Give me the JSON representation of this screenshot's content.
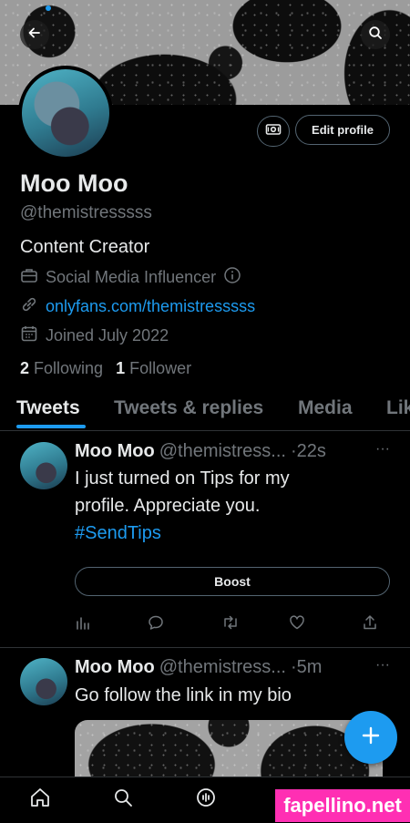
{
  "profile": {
    "name": "Moo Moo",
    "handle": "@themistresssss",
    "bio": "Content Creator",
    "category": "Social Media Influencer",
    "link": "onlyfans.com/themistresssss",
    "joined": "Joined July 2022",
    "following_count": "2",
    "following_label": "Following",
    "followers_count": "1",
    "followers_label": "Follower"
  },
  "header": {
    "edit_profile_label": "Edit profile"
  },
  "tabs": [
    {
      "label": "Tweets",
      "active": true
    },
    {
      "label": "Tweets & replies",
      "active": false
    },
    {
      "label": "Media",
      "active": false
    },
    {
      "label": "Lik",
      "active": false
    }
  ],
  "tweets": [
    {
      "name": "Moo Moo",
      "handle": "@themistress...",
      "time": "·22s",
      "text_line1": "I just turned on Tips for my",
      "text_line2": "profile. Appreciate you.",
      "hashtag": "#SendTips",
      "boost_label": "Boost"
    },
    {
      "name": "Moo Moo",
      "handle": "@themistress...",
      "time": "·5m",
      "text": "Go follow the link in my bio"
    }
  ],
  "watermark": "fapellino.net",
  "colors": {
    "accent": "#1d9bf0",
    "background": "#000000",
    "secondary_text": "#71767b",
    "watermark_bg": "#ff2fb3"
  }
}
